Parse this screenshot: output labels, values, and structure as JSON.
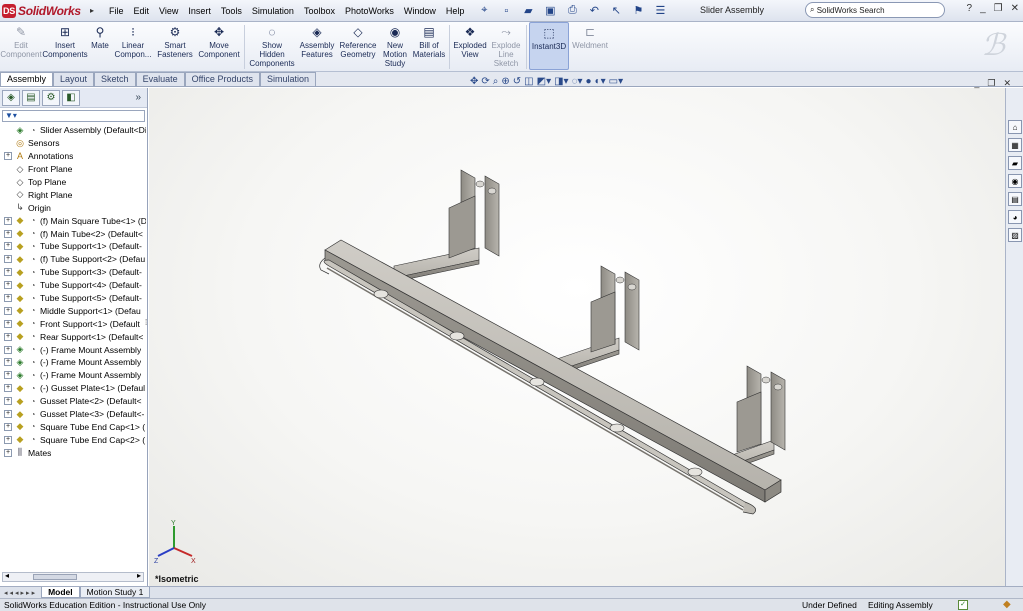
{
  "app": {
    "brand": "SolidWorks",
    "window_title": "Slider Assembly"
  },
  "menu": [
    "File",
    "Edit",
    "View",
    "Insert",
    "Tools",
    "Simulation",
    "Toolbox",
    "PhotoWorks",
    "Window",
    "Help"
  ],
  "search": {
    "placeholder": "SolidWorks Search"
  },
  "ribbon": [
    {
      "label": "Edit\nComponent",
      "icon": "edit-component-icon",
      "disabled": true
    },
    {
      "label": "Insert\nComponents",
      "icon": "insert-components-icon"
    },
    {
      "label": "Mate",
      "icon": "mate-icon"
    },
    {
      "label": "Linear\nCompon...",
      "icon": "linear-pattern-icon"
    },
    {
      "label": "Smart\nFasteners",
      "icon": "smart-fasteners-icon"
    },
    {
      "label": "Move\nComponent",
      "icon": "move-component-icon"
    },
    {
      "label": "Show\nHidden\nComponents",
      "icon": "show-hidden-icon"
    },
    {
      "label": "Assembly\nFeatures",
      "icon": "assembly-features-icon"
    },
    {
      "label": "Reference\nGeometry",
      "icon": "reference-geometry-icon"
    },
    {
      "label": "New\nMotion\nStudy",
      "icon": "motion-study-icon"
    },
    {
      "label": "Bill of\nMaterials",
      "icon": "bom-icon"
    },
    {
      "label": "Exploded\nView",
      "icon": "exploded-view-icon"
    },
    {
      "label": "Explode\nLine\nSketch",
      "icon": "explode-line-icon",
      "disabled": true
    },
    {
      "label": "Instant3D",
      "icon": "instant3d-icon",
      "active": true
    },
    {
      "label": "Weldment",
      "icon": "weldment-icon",
      "disabled": true
    }
  ],
  "tabs": [
    "Assembly",
    "Layout",
    "Sketch",
    "Evaluate",
    "Office Products",
    "Simulation"
  ],
  "tree": [
    {
      "label": "Slider Assembly  (Default<Disp",
      "icon": "assembly-icon",
      "expand": false,
      "top": true
    },
    {
      "label": "Sensors",
      "icon": "sensors-icon"
    },
    {
      "label": "Annotations",
      "icon": "annotations-icon",
      "expand": true
    },
    {
      "label": "Front Plane",
      "icon": "plane-icon"
    },
    {
      "label": "Top Plane",
      "icon": "plane-icon"
    },
    {
      "label": "Right Plane",
      "icon": "plane-icon"
    },
    {
      "label": "Origin",
      "icon": "origin-icon"
    },
    {
      "label": "(f) Main Square Tube<1> (D",
      "icon": "part-icon",
      "expand": true
    },
    {
      "label": "(f) Main Tube<2> (Default<",
      "icon": "part-icon",
      "expand": true
    },
    {
      "label": "Tube Support<1> (Default-",
      "icon": "part-icon",
      "expand": true
    },
    {
      "label": "(f) Tube Support<2> (Defau",
      "icon": "part-icon",
      "expand": true
    },
    {
      "label": "Tube Support<3> (Default-",
      "icon": "part-icon",
      "expand": true
    },
    {
      "label": "Tube Support<4> (Default-",
      "icon": "part-icon",
      "expand": true
    },
    {
      "label": "Tube Support<5> (Default-",
      "icon": "part-icon",
      "expand": true
    },
    {
      "label": "Middle Support<1> (Defau",
      "icon": "part-icon",
      "expand": true
    },
    {
      "label": "Front Support<1> (Default",
      "icon": "part-icon",
      "expand": true
    },
    {
      "label": "Rear Support<1> (Default<",
      "icon": "part-icon",
      "expand": true
    },
    {
      "label": "(-) Frame Mount Assembly",
      "icon": "subassembly-icon",
      "expand": true
    },
    {
      "label": "(-) Frame Mount Assembly",
      "icon": "subassembly-icon",
      "expand": true
    },
    {
      "label": "(-) Frame Mount Assembly",
      "icon": "subassembly-icon",
      "expand": true
    },
    {
      "label": "(-) Gusset Plate<1> (Defaul",
      "icon": "part-icon",
      "expand": true
    },
    {
      "label": "Gusset Plate<2> (Default<",
      "icon": "part-icon",
      "expand": true
    },
    {
      "label": "Gusset Plate<3> (Default<-",
      "icon": "part-icon",
      "expand": true
    },
    {
      "label": "Square Tube End Cap<1> (",
      "icon": "part-icon",
      "expand": true
    },
    {
      "label": "Square Tube End Cap<2> (",
      "icon": "part-icon",
      "expand": true
    },
    {
      "label": "Mates",
      "icon": "mates-icon",
      "expand": true
    }
  ],
  "viewport": {
    "view_name": "*Isometric"
  },
  "bottom_tabs": [
    "Model",
    "Motion Study 1"
  ],
  "status": {
    "edition": "SolidWorks Education Edition - Instructional Use Only",
    "definition": "Under Defined",
    "mode": "Editing Assembly"
  },
  "colors": {
    "accent": "#c51f2f",
    "ribbon_active": "#c6d4ef",
    "model_gray": "#a8a59e"
  }
}
